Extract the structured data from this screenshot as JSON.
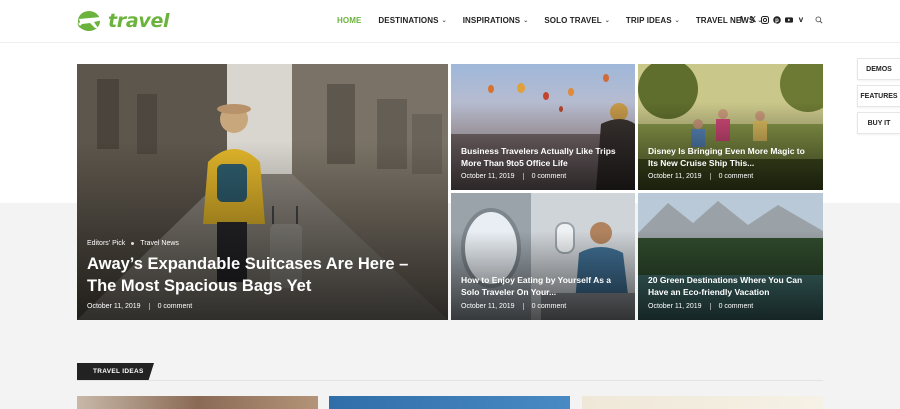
{
  "brand": {
    "name": "travel",
    "color": "#6cb33e"
  },
  "nav": [
    {
      "label": "HOME",
      "active": true,
      "dropdown": false
    },
    {
      "label": "DESTINATIONS",
      "dropdown": true
    },
    {
      "label": "INSPIRATIONS",
      "dropdown": true
    },
    {
      "label": "SOLO TRAVEL",
      "dropdown": true
    },
    {
      "label": "TRIP IDEAS",
      "dropdown": true
    },
    {
      "label": "TRAVEL NEWS",
      "dropdown": true
    }
  ],
  "social": [
    "facebook-icon",
    "x-icon",
    "instagram-icon",
    "pinterest-icon",
    "youtube-icon",
    "vimeo-icon"
  ],
  "side_buttons": [
    "DEMOS",
    "FEATURES",
    "BUY IT"
  ],
  "featured": {
    "cats": [
      "Editors' Pick",
      "Travel News"
    ],
    "title": "Away’s Expandable Suitcases Are Here – The Most Spacious Bags Yet",
    "date": "October 11, 2019",
    "comments": "0 comment"
  },
  "posts": [
    {
      "title": "Business Travelers Actually Like Trips More Than 9to5 Office Life",
      "date": "October 11, 2019",
      "comments": "0 comment"
    },
    {
      "title": "Disney Is Bringing Even More Magic to Its New Cruise Ship This...",
      "date": "October 11, 2019",
      "comments": "0 comment"
    },
    {
      "title": "How to Enjoy Eating by Yourself As a Solo Traveler On Your...",
      "date": "October 11, 2019",
      "comments": "0 comment"
    },
    {
      "title": "20 Green Destinations Where You Can Have an Eco-friendly Vacation",
      "date": "October 11, 2019",
      "comments": "0 comment"
    }
  ],
  "section": {
    "label": "TRAVEL IDEAS"
  }
}
